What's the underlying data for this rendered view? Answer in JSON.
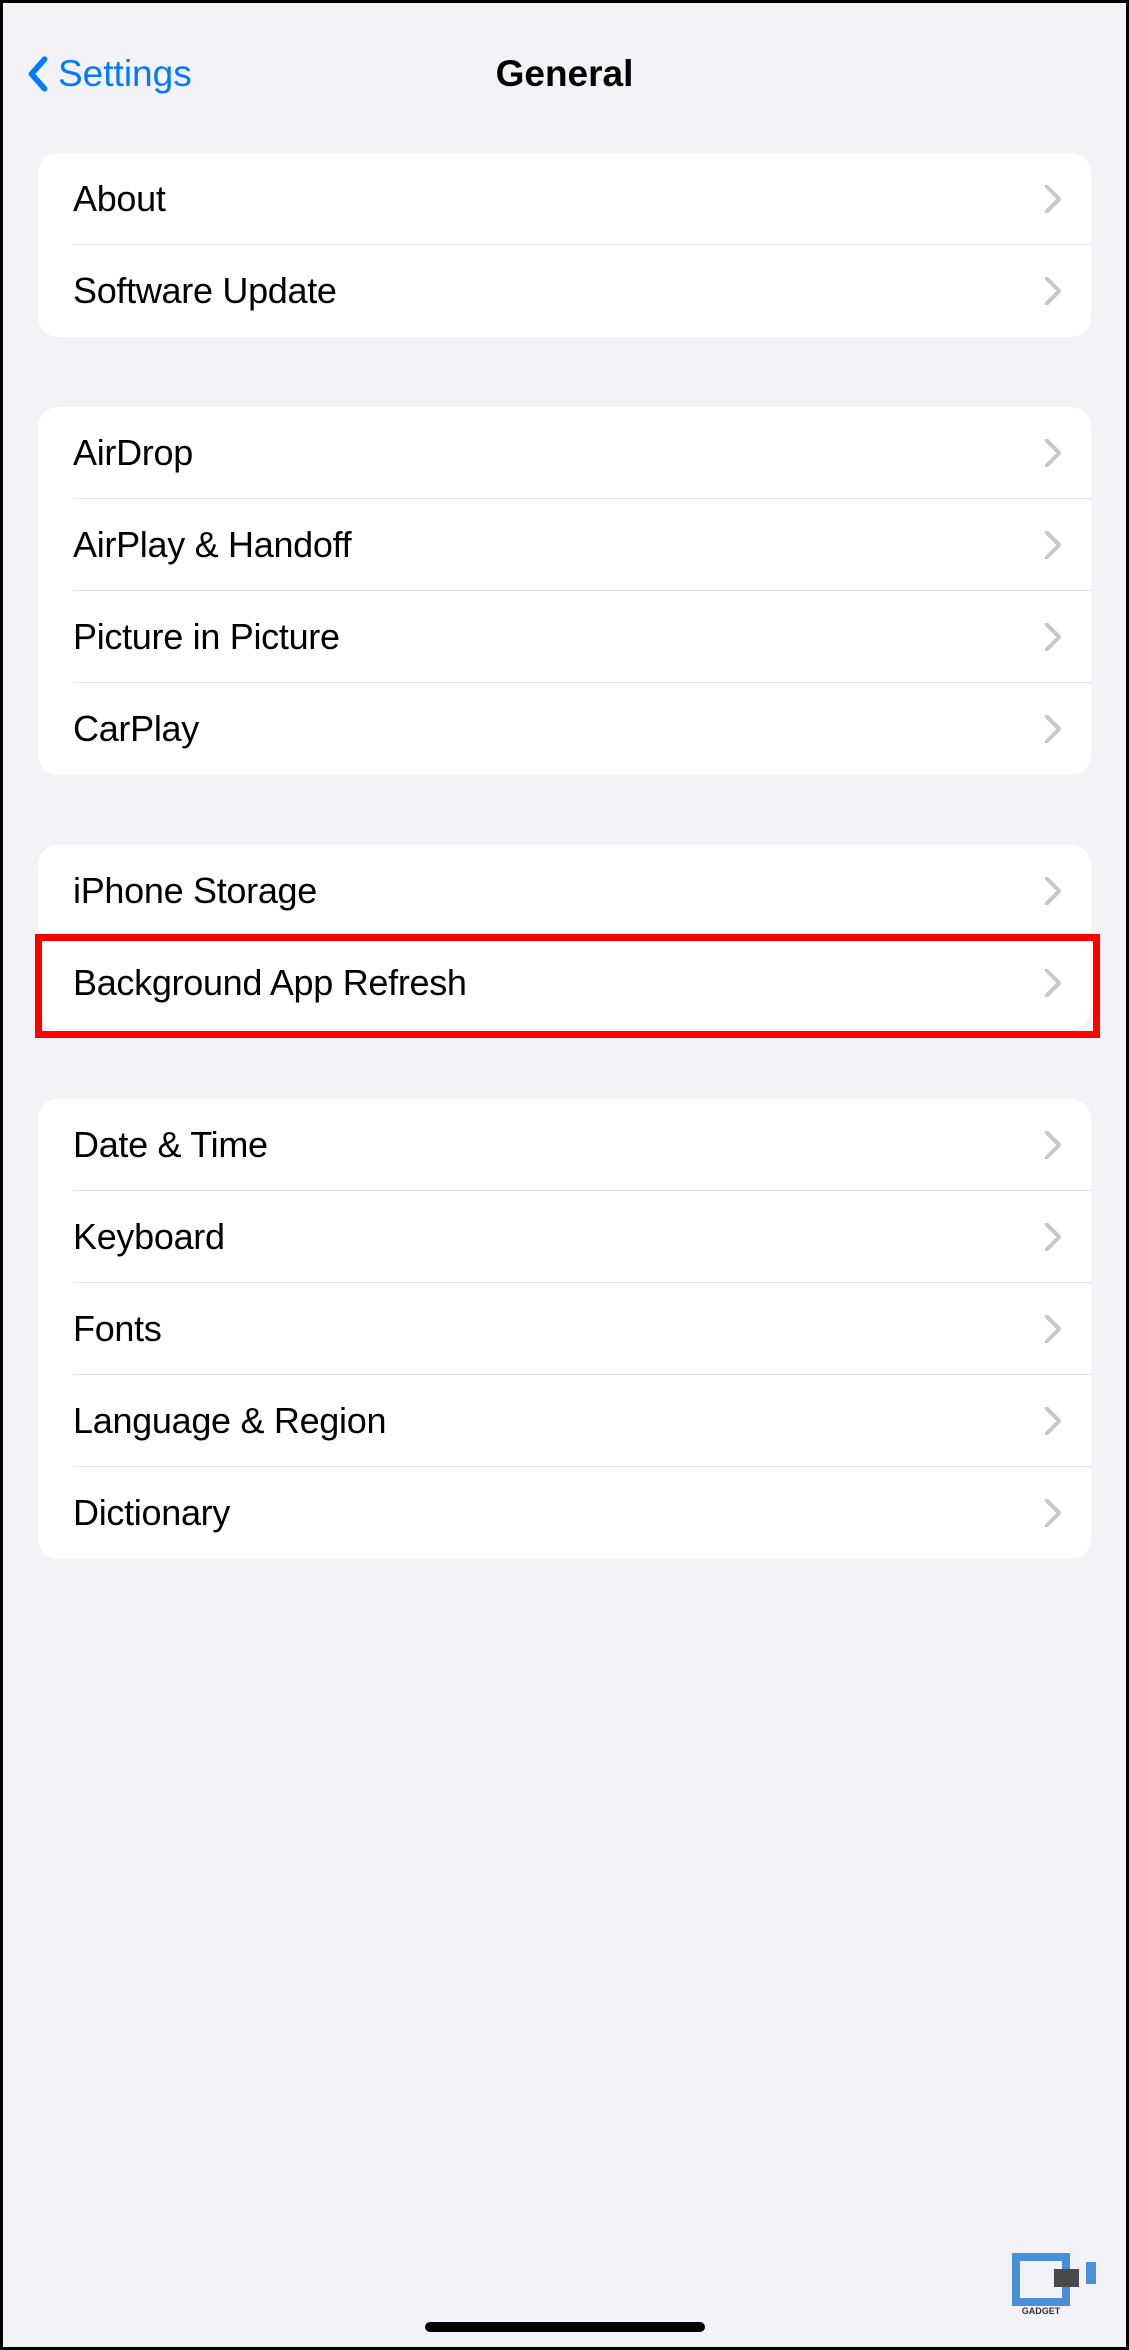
{
  "header": {
    "back_label": "Settings",
    "title": "General"
  },
  "sections": [
    {
      "id": "about-section",
      "items": [
        {
          "id": "about",
          "label": "About"
        },
        {
          "id": "software-update",
          "label": "Software Update"
        }
      ]
    },
    {
      "id": "connectivity-section",
      "items": [
        {
          "id": "airdrop",
          "label": "AirDrop"
        },
        {
          "id": "airplay-handoff",
          "label": "AirPlay & Handoff"
        },
        {
          "id": "picture-in-picture",
          "label": "Picture in Picture"
        },
        {
          "id": "carplay",
          "label": "CarPlay"
        }
      ]
    },
    {
      "id": "storage-section",
      "items": [
        {
          "id": "iphone-storage",
          "label": "iPhone Storage"
        },
        {
          "id": "background-app-refresh",
          "label": "Background App Refresh",
          "highlighted": true
        }
      ]
    },
    {
      "id": "system-section",
      "items": [
        {
          "id": "date-time",
          "label": "Date & Time"
        },
        {
          "id": "keyboard",
          "label": "Keyboard"
        },
        {
          "id": "fonts",
          "label": "Fonts"
        },
        {
          "id": "language-region",
          "label": "Language & Region"
        },
        {
          "id": "dictionary",
          "label": "Dictionary"
        }
      ]
    }
  ],
  "watermark": "GADGET",
  "colors": {
    "link": "#007aff",
    "background": "#f2f2f7",
    "card": "#ffffff",
    "separator": "#e4e4e8",
    "chevron": "#c7c7cc",
    "highlight": "#ff0000"
  }
}
